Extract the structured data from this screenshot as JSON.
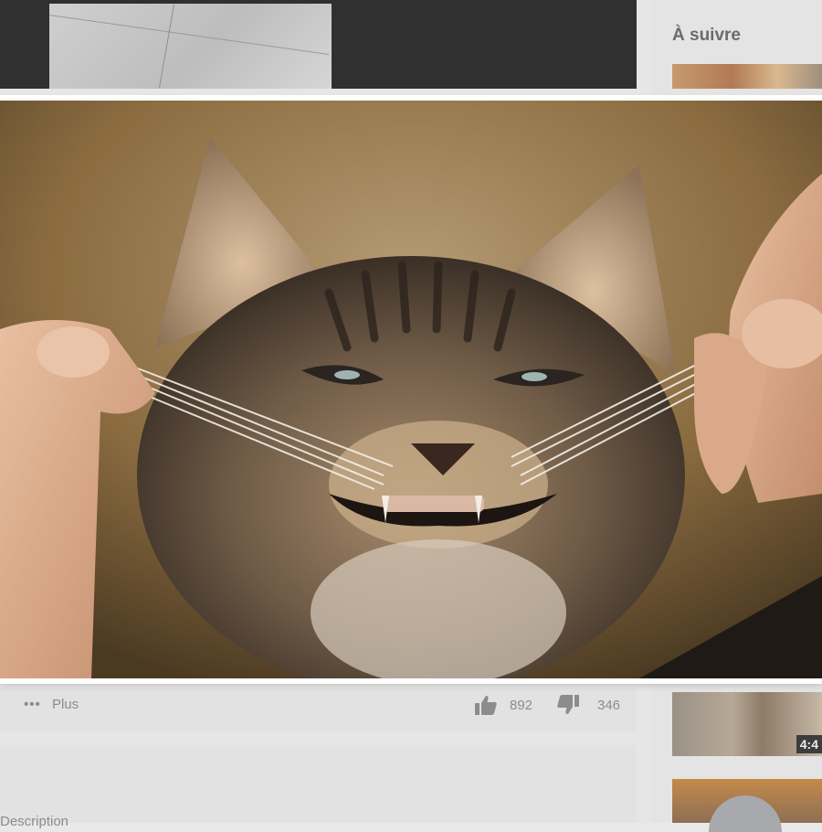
{
  "sidebar": {
    "title": "À suivre",
    "items": [
      {
        "duration": ""
      },
      {
        "duration": "4:4"
      },
      {
        "duration": ""
      }
    ]
  },
  "video_actions": {
    "more_label": "Plus",
    "more_icon": "more-dots-icon",
    "likes": "892",
    "like_icon": "thumbs-up-icon",
    "dislikes": "346",
    "dislike_icon": "thumbs-down-icon"
  },
  "description": {
    "label": "Description"
  },
  "lightbox": {
    "image_subject": "kitten-whiskers-photo"
  },
  "colors": {
    "page_bg": "#e6e6e6",
    "player_bg": "#303030",
    "muted_text": "#8c8c8c"
  }
}
